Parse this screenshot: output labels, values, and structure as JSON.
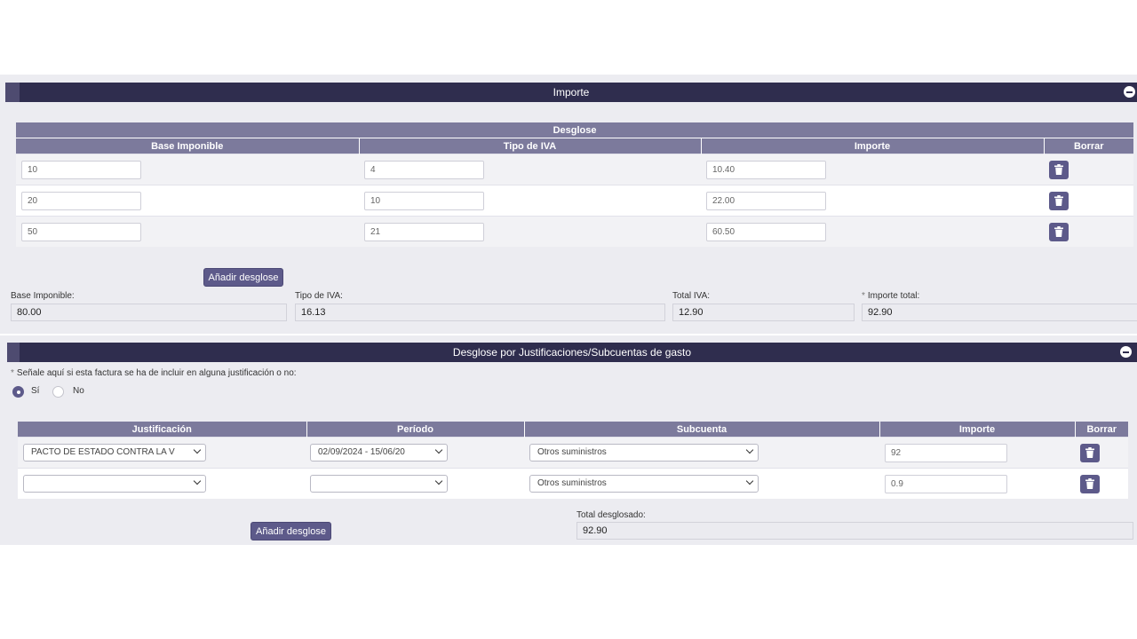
{
  "importe": {
    "header": "Importe",
    "desglose_title": "Desglose",
    "columns": [
      "Base Imponible",
      "Tipo de IVA",
      "Importe",
      "Borrar"
    ],
    "rows": [
      {
        "base": "10",
        "tipo": "4",
        "importe": "10.40"
      },
      {
        "base": "20",
        "tipo": "10",
        "importe": "22.00"
      },
      {
        "base": "50",
        "tipo": "21",
        "importe": "60.50"
      }
    ],
    "add_button": "Añadir desglose",
    "totals": {
      "base_label": "Base Imponible:",
      "base_value": "80.00",
      "tipo_label": "Tipo de IVA:",
      "tipo_value": "16.13",
      "iva_label": "Total IVA:",
      "iva_value": "12.90",
      "total_label": "Importe total:",
      "total_value": "92.90",
      "required_mark": "*"
    }
  },
  "justificaciones": {
    "header": "Desglose por Justificaciones/Subcuentas de gasto",
    "question": "Señale aquí si esta factura se ha de incluir en alguna justificación o no:",
    "required_mark": "*",
    "options": {
      "yes": "Sí",
      "no": "No",
      "selected": "yes"
    },
    "columns": [
      "Justificación",
      "Período",
      "Subcuenta",
      "Importe",
      "Borrar"
    ],
    "rows": [
      {
        "justificacion": "PACTO DE ESTADO CONTRA LA V",
        "periodo": "02/09/2024 - 15/06/20",
        "subcuenta": "Otros suministros",
        "importe": "92"
      },
      {
        "justificacion": "",
        "periodo": "",
        "subcuenta": "Otros suministros",
        "importe": "0.9"
      }
    ],
    "add_button": "Añadir desglose",
    "total_label": "Total desglosado:",
    "total_value": "92.90"
  },
  "colors": {
    "header_bg": "#2f2d4e",
    "table_header_bg": "#7c7a9c",
    "button_bg": "#5d5a8a",
    "panel_bg": "#ececf1"
  },
  "icons": {
    "collapse": "minus-circle-icon",
    "delete": "trash-icon",
    "dropdown": "chevron-down-icon"
  }
}
